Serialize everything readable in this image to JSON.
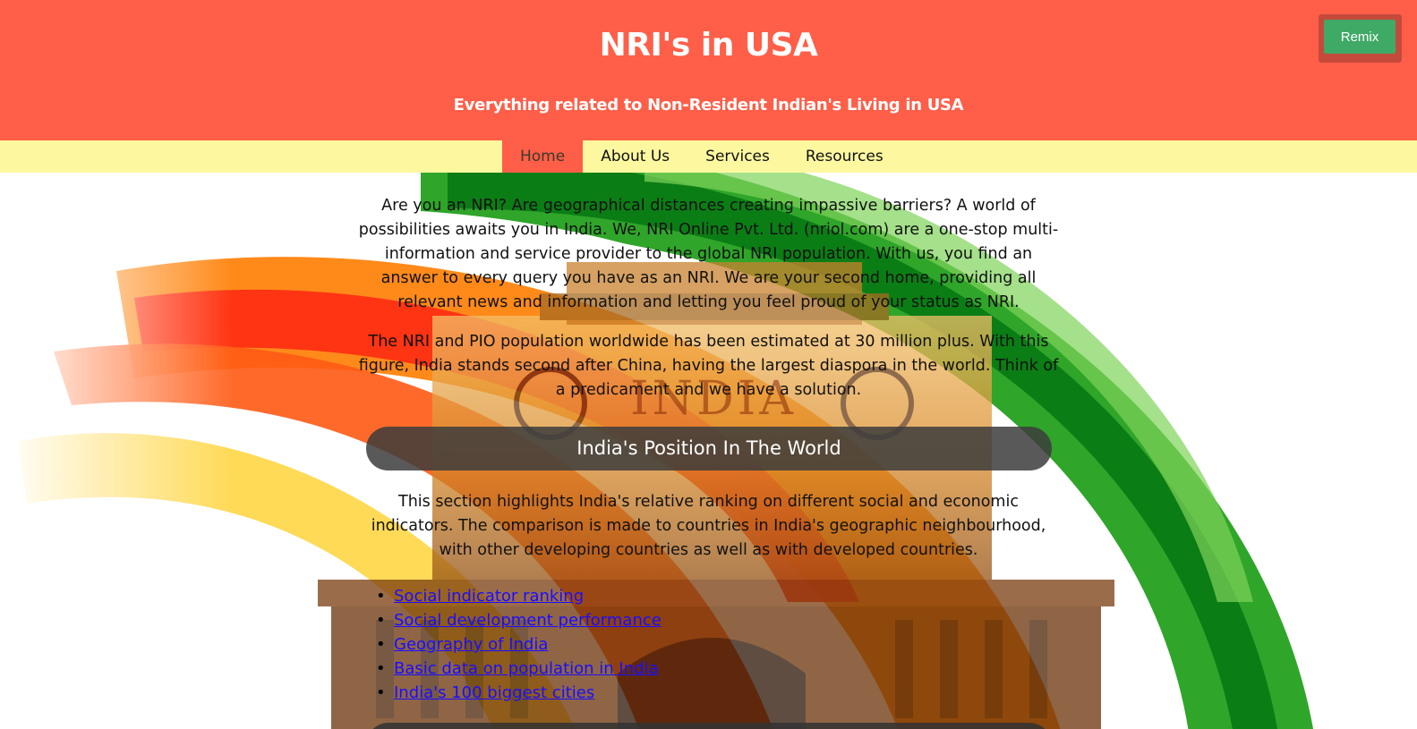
{
  "header": {
    "title": "NRI's in USA",
    "subtitle": "Everything related to Non-Resident Indian's Living in USA",
    "remix_label": "Remix"
  },
  "nav": {
    "items": [
      {
        "label": "Home",
        "active": true
      },
      {
        "label": "About Us",
        "active": false
      },
      {
        "label": "Services",
        "active": false
      },
      {
        "label": "Resources",
        "active": false
      }
    ]
  },
  "main": {
    "intro": "Are you an NRI? Are geographical distances creating impassive barriers? A world of possibilities awaits you in India. We, NRI Online Pvt. Ltd. (nriol.com) are a one-stop multi-information and service provider to the global NRI population. With us, you find an answer to every query you have as an NRI. We are your second home, providing all relevant news and information and letting you feel proud of your status as NRI.",
    "population": "The NRI and PIO population worldwide has been estimated at 30 million plus. With this figure, India stands second after China, having the largest diaspora in the world. Think of a predicament and we have a solution.",
    "section_title": "India's Position In The World",
    "section_text": "This section highlights India's relative ranking on different social and economic indicators. The comparison is made to countries in India's geographic neighbourhood, with other developing countries as well as with developed countries.",
    "links": [
      "Social indicator ranking",
      "Social development performance",
      "Geography of India",
      "Basic data on population in India",
      "India's 100 biggest cities"
    ],
    "background_text": "INDIA"
  },
  "colors": {
    "header_bg": "#ff5e48",
    "nav_bg": "#fdf8a0",
    "remix_bg": "#3faa66",
    "link": "#1a0dff",
    "section_bar": "#3c3c3c"
  }
}
